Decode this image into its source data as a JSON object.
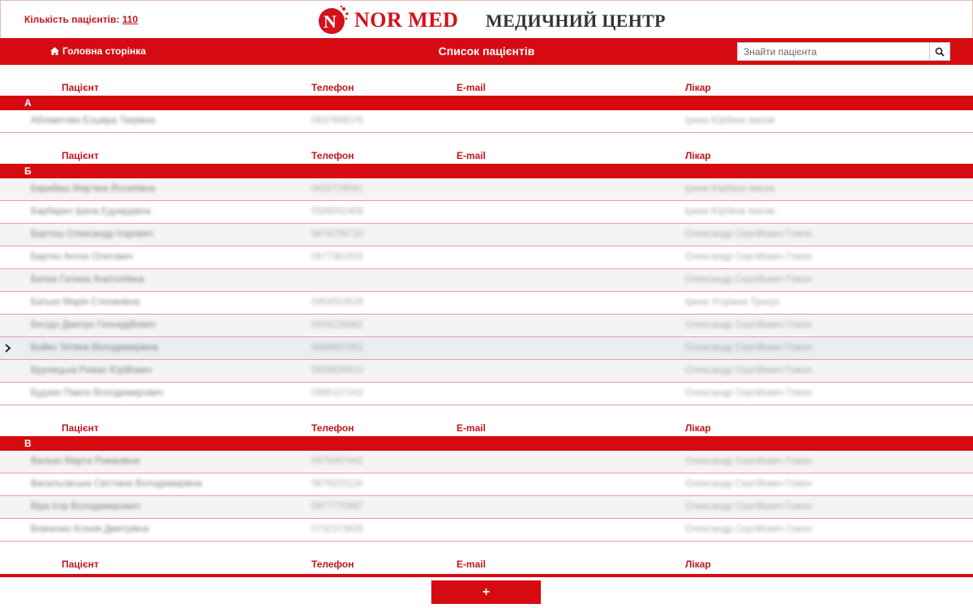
{
  "header": {
    "patient_count_label": "Кількість пацієнтів:",
    "patient_count": "110",
    "logo_text": "NOR MED",
    "title": "МЕДИЧНИЙ ЦЕНТР"
  },
  "nav": {
    "home_label": "Головна сторінка",
    "title": "Список пацієнтів",
    "search_placeholder": "Знайти пацієнта"
  },
  "columns": {
    "patient": "Пацієнт",
    "phone": "Телефон",
    "email": "E-mail",
    "doctor": "Лікар"
  },
  "groups": [
    {
      "letter": "А",
      "rows": [
        {
          "name": "Аблямітова Ельвіра Таїрівна",
          "phone": "0937998376",
          "doctor": "Ірина Юріївна Івасик"
        }
      ]
    },
    {
      "letter": "Б",
      "rows": [
        {
          "name": "Барабаш Мар'яна Йосипівна",
          "phone": "0632729091",
          "doctor": "Ірина Юріївна Івасик"
        },
        {
          "name": "Барбарич Ірина Едуардівна",
          "phone": "0506002408",
          "doctor": "Ірина Юріївна Івасик"
        },
        {
          "name": "Бартош Олександр Ігорович",
          "phone": "0676706720",
          "doctor": "Олександр Сергійович Гомон"
        },
        {
          "name": "Бартко Антон Олегович",
          "phone": "0677381929",
          "doctor": "Олександр Сергійович Гомон"
        },
        {
          "name": "Батюк Галина Анатоліївна",
          "phone": "",
          "doctor": "Олександр Сергійович Гомон"
        },
        {
          "name": "Батько Марія Степанівна",
          "phone": "0954553528",
          "doctor": "Ірина Угорівна Трихух"
        },
        {
          "name": "Бесідо Дмитро Геннадійович",
          "phone": "0509226682",
          "doctor": "Олександр Сергійович Гомон"
        },
        {
          "name": "Бойко Тетяна Володимирівна",
          "phone": "0689907261",
          "doctor": "Олександр Сергійович Гомон",
          "selected": true
        },
        {
          "name": "Бруницька Роман Юрійович",
          "phone": "0938839915",
          "doctor": "Олександр Сергійович Гомон"
        },
        {
          "name": "Будзин Павло Володимирович",
          "phone": "0985107242",
          "doctor": "Олександр Сергійович Гомон"
        }
      ]
    },
    {
      "letter": "В",
      "rows": [
        {
          "name": "Валько Марта Романівна",
          "phone": "0975007442",
          "doctor": "Олександр Сергійович Гомон"
        },
        {
          "name": "Васильовська Світлана Володимирівна",
          "phone": "0679325116",
          "doctor": "Олександр Сергійович Гомон"
        },
        {
          "name": "Віра Ігор Володимирович",
          "phone": "0977770997",
          "doctor": "Олександр Сергійович Гомон"
        },
        {
          "name": "Вовченко Ксенія Дмитрівна",
          "phone": "0732373828",
          "doctor": "Олександр Сергійович Гомон"
        }
      ]
    }
  ],
  "add_button_label": "+",
  "colors": {
    "accent": "#d60b11",
    "header_text": "#c4161c"
  }
}
